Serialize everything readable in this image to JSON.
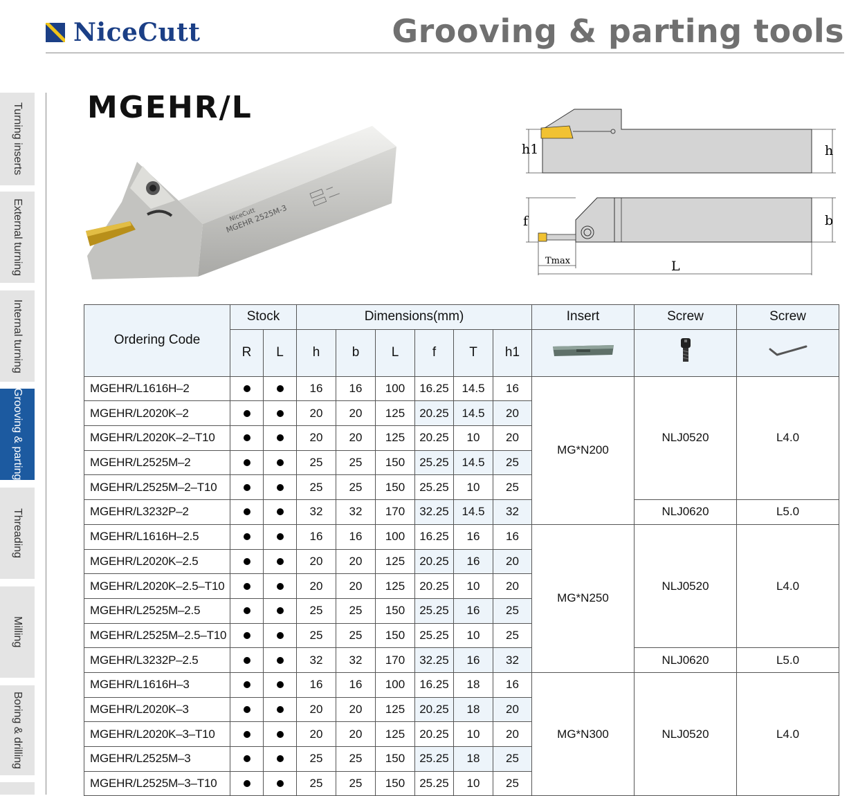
{
  "header": {
    "brand": "NiceCutt",
    "title": "Grooving & parting tools"
  },
  "sidebar": {
    "tabs": [
      "Turning inserts",
      "External turning",
      "Internal turning",
      "Grooving & parting",
      "Threading",
      "Milling",
      "Boring & drilling"
    ],
    "active": "Grooving & parting"
  },
  "product": {
    "title": "MGEHR/L",
    "photo_label_brand": "NiceCutt",
    "photo_label_model": "MGEHR 2525M-3"
  },
  "diagram": {
    "labels": {
      "h1": "h1",
      "h": "h",
      "f": "f",
      "b": "b",
      "tmax": "Tmax",
      "L": "L"
    }
  },
  "table": {
    "headers": {
      "ordering_code": "Ordering Code",
      "stock": "Stock",
      "dimensions": "Dimensions(mm)",
      "insert": "Insert",
      "screw1": "Screw",
      "screw2": "Screw"
    },
    "subheaders": [
      "R",
      "L",
      "h",
      "b",
      "L",
      "f",
      "T",
      "h1"
    ],
    "header_icons": [
      "insert-icon",
      "screw-icon",
      "hex-key-icon"
    ],
    "rows": [
      {
        "code": "MGEHR/L1616H–2",
        "R": "●",
        "L": "●",
        "h": "16",
        "b": "16",
        "len": "100",
        "f": "16.25",
        "T": "14.5",
        "h1": "16"
      },
      {
        "code": "MGEHR/L2020K–2",
        "R": "●",
        "L": "●",
        "h": "20",
        "b": "20",
        "len": "125",
        "f": "20.25",
        "T": "14.5",
        "h1": "20"
      },
      {
        "code": "MGEHR/L2020K–2–T10",
        "R": "●",
        "L": "●",
        "h": "20",
        "b": "20",
        "len": "125",
        "f": "20.25",
        "T": "10",
        "h1": "20"
      },
      {
        "code": "MGEHR/L2525M–2",
        "R": "●",
        "L": "●",
        "h": "25",
        "b": "25",
        "len": "150",
        "f": "25.25",
        "T": "14.5",
        "h1": "25"
      },
      {
        "code": "MGEHR/L2525M–2–T10",
        "R": "●",
        "L": "●",
        "h": "25",
        "b": "25",
        "len": "150",
        "f": "25.25",
        "T": "10",
        "h1": "25"
      },
      {
        "code": "MGEHR/L3232P–2",
        "R": "●",
        "L": "●",
        "h": "32",
        "b": "32",
        "len": "170",
        "f": "32.25",
        "T": "14.5",
        "h1": "32"
      },
      {
        "code": "MGEHR/L1616H–2.5",
        "R": "●",
        "L": "●",
        "h": "16",
        "b": "16",
        "len": "100",
        "f": "16.25",
        "T": "16",
        "h1": "16"
      },
      {
        "code": "MGEHR/L2020K–2.5",
        "R": "●",
        "L": "●",
        "h": "20",
        "b": "20",
        "len": "125",
        "f": "20.25",
        "T": "16",
        "h1": "20"
      },
      {
        "code": "MGEHR/L2020K–2.5–T10",
        "R": "●",
        "L": "●",
        "h": "20",
        "b": "20",
        "len": "125",
        "f": "20.25",
        "T": "10",
        "h1": "20"
      },
      {
        "code": "MGEHR/L2525M–2.5",
        "R": "●",
        "L": "●",
        "h": "25",
        "b": "25",
        "len": "150",
        "f": "25.25",
        "T": "16",
        "h1": "25"
      },
      {
        "code": "MGEHR/L2525M–2.5–T10",
        "R": "●",
        "L": "●",
        "h": "25",
        "b": "25",
        "len": "150",
        "f": "25.25",
        "T": "10",
        "h1": "25"
      },
      {
        "code": "MGEHR/L3232P–2.5",
        "R": "●",
        "L": "●",
        "h": "32",
        "b": "32",
        "len": "170",
        "f": "32.25",
        "T": "16",
        "h1": "32"
      },
      {
        "code": "MGEHR/L1616H–3",
        "R": "●",
        "L": "●",
        "h": "16",
        "b": "16",
        "len": "100",
        "f": "16.25",
        "T": "18",
        "h1": "16"
      },
      {
        "code": "MGEHR/L2020K–3",
        "R": "●",
        "L": "●",
        "h": "20",
        "b": "20",
        "len": "125",
        "f": "20.25",
        "T": "18",
        "h1": "20"
      },
      {
        "code": "MGEHR/L2020K–3–T10",
        "R": "●",
        "L": "●",
        "h": "20",
        "b": "20",
        "len": "125",
        "f": "20.25",
        "T": "10",
        "h1": "20"
      },
      {
        "code": "MGEHR/L2525M–3",
        "R": "●",
        "L": "●",
        "h": "25",
        "b": "25",
        "len": "150",
        "f": "25.25",
        "T": "18",
        "h1": "25"
      },
      {
        "code": "MGEHR/L2525M–3–T10",
        "R": "●",
        "L": "●",
        "h": "25",
        "b": "25",
        "len": "150",
        "f": "25.25",
        "T": "10",
        "h1": "25"
      }
    ],
    "groups": [
      {
        "insert": "MG*N200",
        "screws": [
          {
            "screw": "NLJ0520",
            "key": "L4.0"
          },
          {
            "screw": "NLJ0620",
            "key": "L5.0"
          }
        ]
      },
      {
        "insert": "MG*N250",
        "screws": [
          {
            "screw": "NLJ0520",
            "key": "L4.0"
          },
          {
            "screw": "NLJ0620",
            "key": "L5.0"
          }
        ]
      },
      {
        "insert": "MG*N300",
        "screws": [
          {
            "screw": "NLJ0520",
            "key": "L4.0"
          }
        ]
      }
    ]
  }
}
